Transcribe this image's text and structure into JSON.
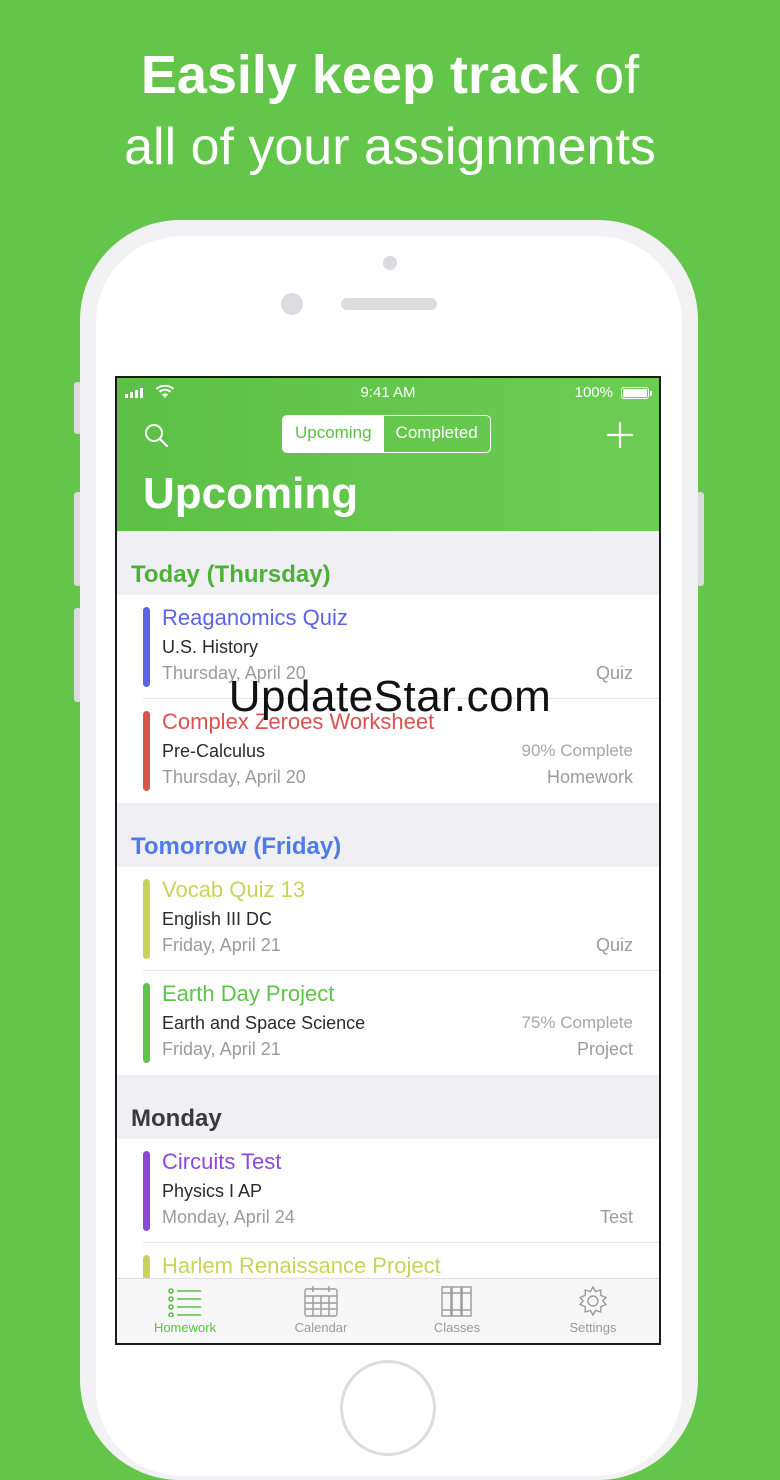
{
  "headline": {
    "bold": "Easily keep track",
    "rest": "of",
    "line2": "all of your assignments"
  },
  "status_bar": {
    "time": "9:41 AM",
    "battery": "100%"
  },
  "segmented": {
    "upcoming": "Upcoming",
    "completed": "Completed"
  },
  "page_title": "Upcoming",
  "sections": [
    {
      "label": "Today (Thursday)",
      "color": "#4fb038",
      "items": [
        {
          "title": "Reaganomics Quiz",
          "course": "U.S. History",
          "date": "Thursday, April 20",
          "progress": "",
          "type": "Quiz",
          "color": "#5b63e6"
        },
        {
          "title": "Complex Zeroes Worksheet",
          "course": "Pre-Calculus",
          "date": "Thursday, April 20",
          "progress": "90% Complete",
          "type": "Homework",
          "color": "#d9534f"
        }
      ]
    },
    {
      "label": "Tomorrow (Friday)",
      "color": "#4f7be8",
      "items": [
        {
          "title": "Vocab Quiz 13",
          "course": "English III DC",
          "date": "Friday, April 21",
          "progress": "",
          "type": "Quiz",
          "color": "#c9d35a"
        },
        {
          "title": "Earth Day Project",
          "course": "Earth and Space Science",
          "date": "Friday, April 21",
          "progress": "75% Complete",
          "type": "Project",
          "color": "#5fc34a"
        }
      ]
    },
    {
      "label": "Monday",
      "color": "#3a3a3a",
      "items": [
        {
          "title": "Circuits Test",
          "course": "Physics I AP",
          "date": "Monday, April 24",
          "progress": "",
          "type": "Test",
          "color": "#8b49d8"
        },
        {
          "title": "Harlem Renaissance Project",
          "course": "",
          "date": "",
          "progress": "",
          "type": "",
          "color": "#c9d35a"
        }
      ]
    }
  ],
  "tabs": [
    {
      "label": "Homework",
      "icon": "list-icon"
    },
    {
      "label": "Calendar",
      "icon": "calendar-icon"
    },
    {
      "label": "Classes",
      "icon": "books-icon"
    },
    {
      "label": "Settings",
      "icon": "gear-icon"
    }
  ],
  "watermark": "UpdateStar.com",
  "colors": {
    "background": "#63c54a",
    "accent": "#5dc046"
  }
}
